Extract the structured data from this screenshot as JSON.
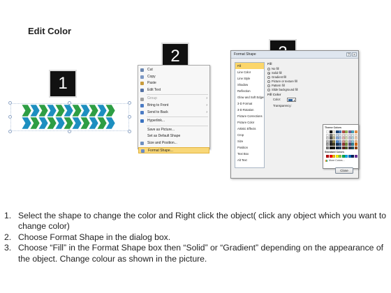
{
  "title": "Edit Color",
  "badges": [
    "1",
    "2",
    "3"
  ],
  "context_menu": {
    "items": [
      {
        "label": "Cut",
        "icon": "scissors-icon",
        "color": "#6a86b0"
      },
      {
        "label": "Copy",
        "icon": "copy-icon",
        "color": "#7d98c4"
      },
      {
        "label": "Paste",
        "icon": "paste-icon",
        "color": "#c89b3c"
      },
      {
        "label": "Edit Text",
        "icon": "text-icon",
        "color": "#5572a5"
      },
      {
        "label": "Group",
        "icon": "group-icon",
        "color": "#a0a0a0",
        "disabled": true,
        "submenu": true
      },
      {
        "label": "Bring to Front",
        "icon": "bring-front-icon",
        "color": "#4b7bc4",
        "submenu": true
      },
      {
        "label": "Send to Back",
        "icon": "send-back-icon",
        "color": "#4b7bc4",
        "submenu": true
      },
      {
        "label": "Hyperlink...",
        "icon": "hyperlink-icon",
        "color": "#3a72c0"
      },
      {
        "label": "Save as Picture...",
        "icon": "",
        "color": ""
      },
      {
        "label": "Set as Default Shape",
        "icon": "",
        "color": ""
      },
      {
        "label": "Size and Position...",
        "icon": "size-position-icon",
        "color": "#6e8fbf"
      },
      {
        "label": "Format Shape...",
        "icon": "format-shape-icon",
        "color": "#6a8cc8",
        "highlight": true
      }
    ]
  },
  "dialog": {
    "title": "Format Shape",
    "categories": [
      "Fill",
      "Line Color",
      "Line Style",
      "Shadow",
      "Reflection",
      "Glow and Soft Edges",
      "3-D Format",
      "3-D Rotation",
      "Picture Corrections",
      "Picture Color",
      "Artistic Effects",
      "Crop",
      "Size",
      "Position",
      "Text Box",
      "Alt Text"
    ],
    "panel_heading": "Fill",
    "fill_options": [
      {
        "label": "No fill",
        "checked": false
      },
      {
        "label": "Solid fill",
        "checked": true
      },
      {
        "label": "Gradient fill",
        "checked": false
      },
      {
        "label": "Picture or texture fill",
        "checked": false
      },
      {
        "label": "Pattern fill",
        "checked": false
      },
      {
        "label": "Slide background fill",
        "checked": false
      }
    ],
    "fill_color_heading": "Fill Color",
    "color_label": "Color:",
    "transparency_label": "Transparency:",
    "selected_color": "#2d5f99",
    "theme_colors_label": "Theme Colors",
    "standard_colors_label": "Standard Colors",
    "more_colors_label": "More Colors...",
    "close_label": "Close",
    "theme_colors": [
      [
        "#ffffff",
        "#000000",
        "#eeece1",
        "#1f497d",
        "#4f81bd",
        "#c0504d",
        "#9bbb59",
        "#8064a2",
        "#4bacc6",
        "#f79646"
      ],
      [
        "#f2f2f2",
        "#7f7f7f",
        "#ddd9c3",
        "#c6d9f0",
        "#dbe5f1",
        "#f2dcdb",
        "#ebf1dd",
        "#e5e0ec",
        "#dbeef3",
        "#fdeada"
      ],
      [
        "#d8d8d8",
        "#595959",
        "#c4bd97",
        "#8db3e2",
        "#b8cce4",
        "#e5b9b7",
        "#d7e3bc",
        "#ccc1d9",
        "#b7dde8",
        "#fbd5b5"
      ],
      [
        "#bfbfbf",
        "#3f3f3f",
        "#938953",
        "#548dd4",
        "#95b3d7",
        "#d99694",
        "#c3d69b",
        "#b2a2c7",
        "#92cddc",
        "#fac08f"
      ],
      [
        "#a5a5a5",
        "#262626",
        "#494429",
        "#17365d",
        "#366092",
        "#953734",
        "#76923c",
        "#5f497a",
        "#31859b",
        "#e36c09"
      ],
      [
        "#7f7f7f",
        "#0c0c0c",
        "#1d1b10",
        "#0f243e",
        "#244061",
        "#632423",
        "#4f6128",
        "#3f3151",
        "#205867",
        "#974806"
      ]
    ],
    "standard_colors": [
      "#c00000",
      "#ff0000",
      "#ffc000",
      "#ffff00",
      "#92d050",
      "#00b050",
      "#00b0f0",
      "#0070c0",
      "#002060",
      "#7030a0"
    ]
  },
  "instructions": [
    {
      "num": "1.",
      "text": "Select the shape to change the color and Right click the object( click any object which you want to change color)"
    },
    {
      "num": "2.",
      "text": "Choose Format Shape in the dialog box."
    },
    {
      "num": "3.",
      "text": "Choose “Fill” in the Format Shape box then “Solid” or “Gradient” depending on the appearance of the object. Change colour as shown in the picture."
    }
  ],
  "chevron_colors": [
    "#2e9e44",
    "#1d8fc0"
  ]
}
